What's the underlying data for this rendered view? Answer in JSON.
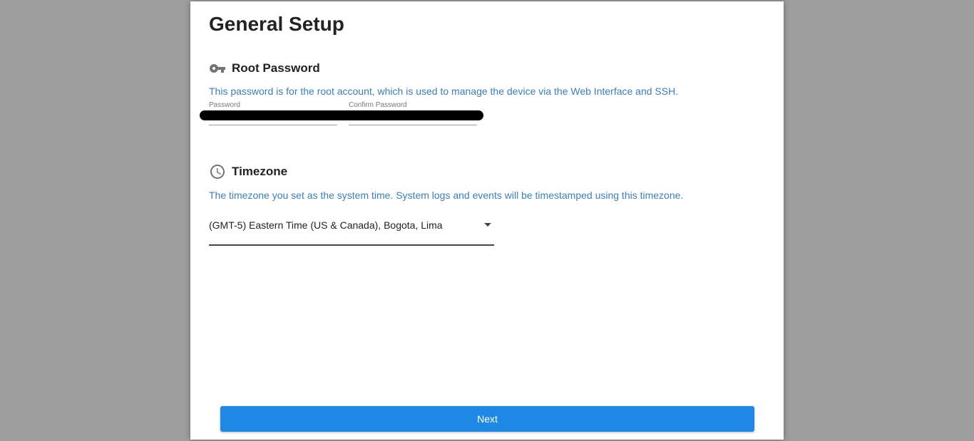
{
  "page": {
    "title": "General Setup"
  },
  "root_password": {
    "heading": "Root Password",
    "icon": "key-icon",
    "description": "This password is for the root account, which is used to manage the device via the Web Interface and SSH.",
    "password_label": "Password",
    "confirm_label": "Confirm Password"
  },
  "timezone": {
    "heading": "Timezone",
    "icon": "clock-icon",
    "description": "The timezone you set as the system time. System logs and events will be timestamped using this timezone.",
    "selected": "(GMT-5) Eastern Time (US & Canada), Bogota, Lima"
  },
  "actions": {
    "next_label": "Next"
  },
  "colors": {
    "accent": "#1e88e5",
    "description_text": "#3a7ebf",
    "backdrop": "#9e9e9e"
  }
}
